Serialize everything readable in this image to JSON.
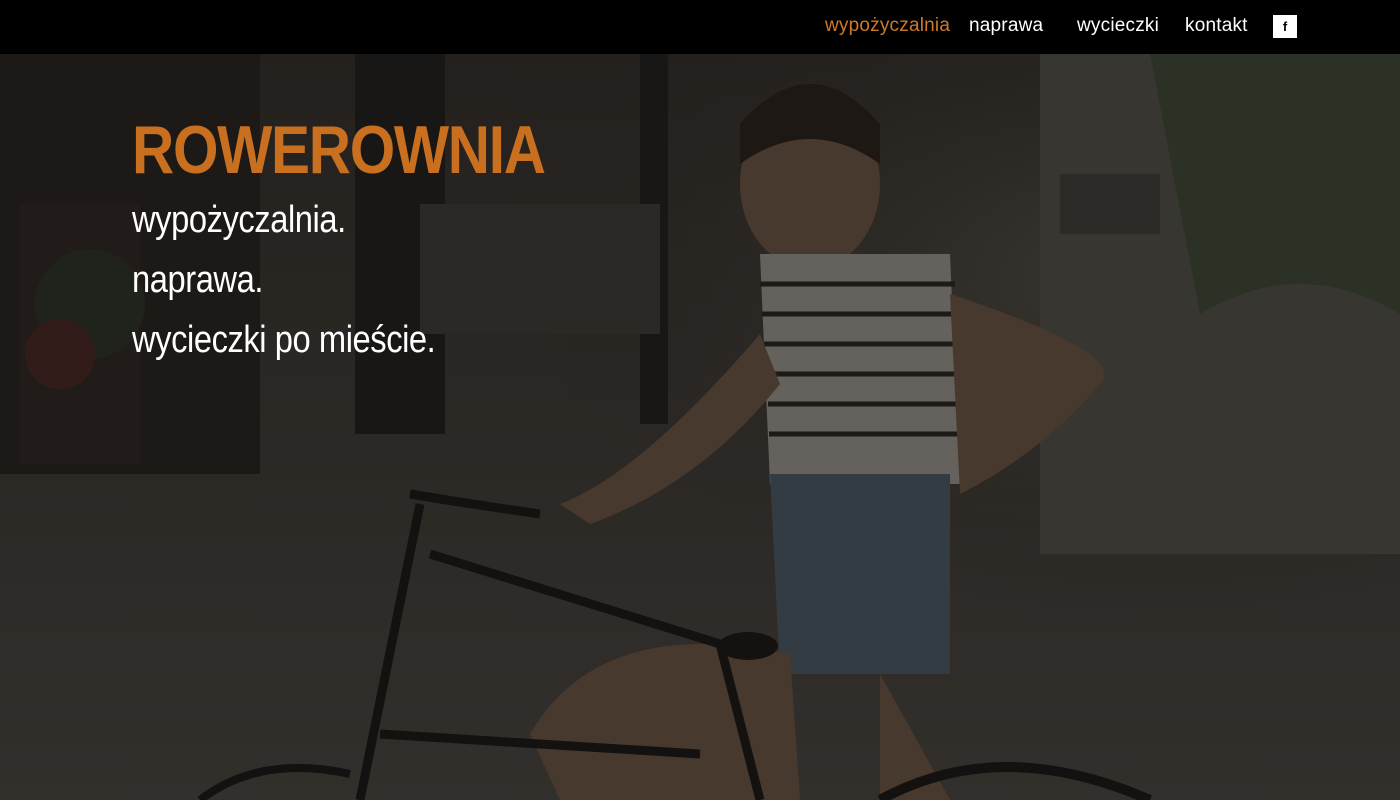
{
  "nav": {
    "items": [
      {
        "label": "wypożyczalnia",
        "active": true
      },
      {
        "label": "naprawa",
        "active": false
      },
      {
        "label": "wycieczki",
        "active": false
      },
      {
        "label": "kontakt",
        "active": false
      }
    ],
    "facebook_label": "f",
    "facebook_icon": "facebook-icon"
  },
  "hero": {
    "title": "ROWEROWNIA",
    "lines": [
      "wypożyczalnia.",
      "naprawa.",
      "wycieczki po mieście."
    ],
    "background": "photo-woman-on-bicycle"
  },
  "colors": {
    "accent": "#c8701f",
    "nav_active": "#d0782a",
    "topbar": "#000000",
    "text": "#ffffff"
  }
}
